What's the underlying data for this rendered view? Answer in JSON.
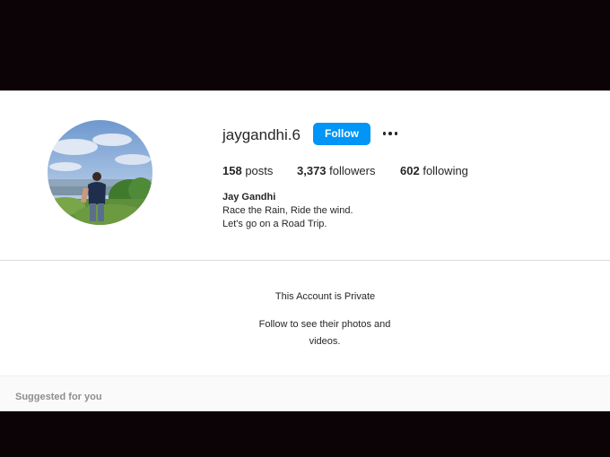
{
  "profile": {
    "username": "jaygandhi.6",
    "follow_label": "Follow",
    "more_icon": "more-dots-icon",
    "stats": {
      "posts_count": "158",
      "posts_label": "posts",
      "followers_count": "3,373",
      "followers_label": "followers",
      "following_count": "602",
      "following_label": "following"
    },
    "bio": {
      "name": "Jay Gandhi",
      "line1": "Race the Rain, Ride the wind.",
      "line2": "Let's go on a Road Trip."
    }
  },
  "private_notice": {
    "title": "This Account is Private",
    "subtitle": "Follow to see their photos and videos."
  },
  "suggested": {
    "heading": "Suggested for you"
  },
  "colors": {
    "accent": "#0095f6",
    "text": "#262626",
    "muted": "#8e8e8e"
  }
}
